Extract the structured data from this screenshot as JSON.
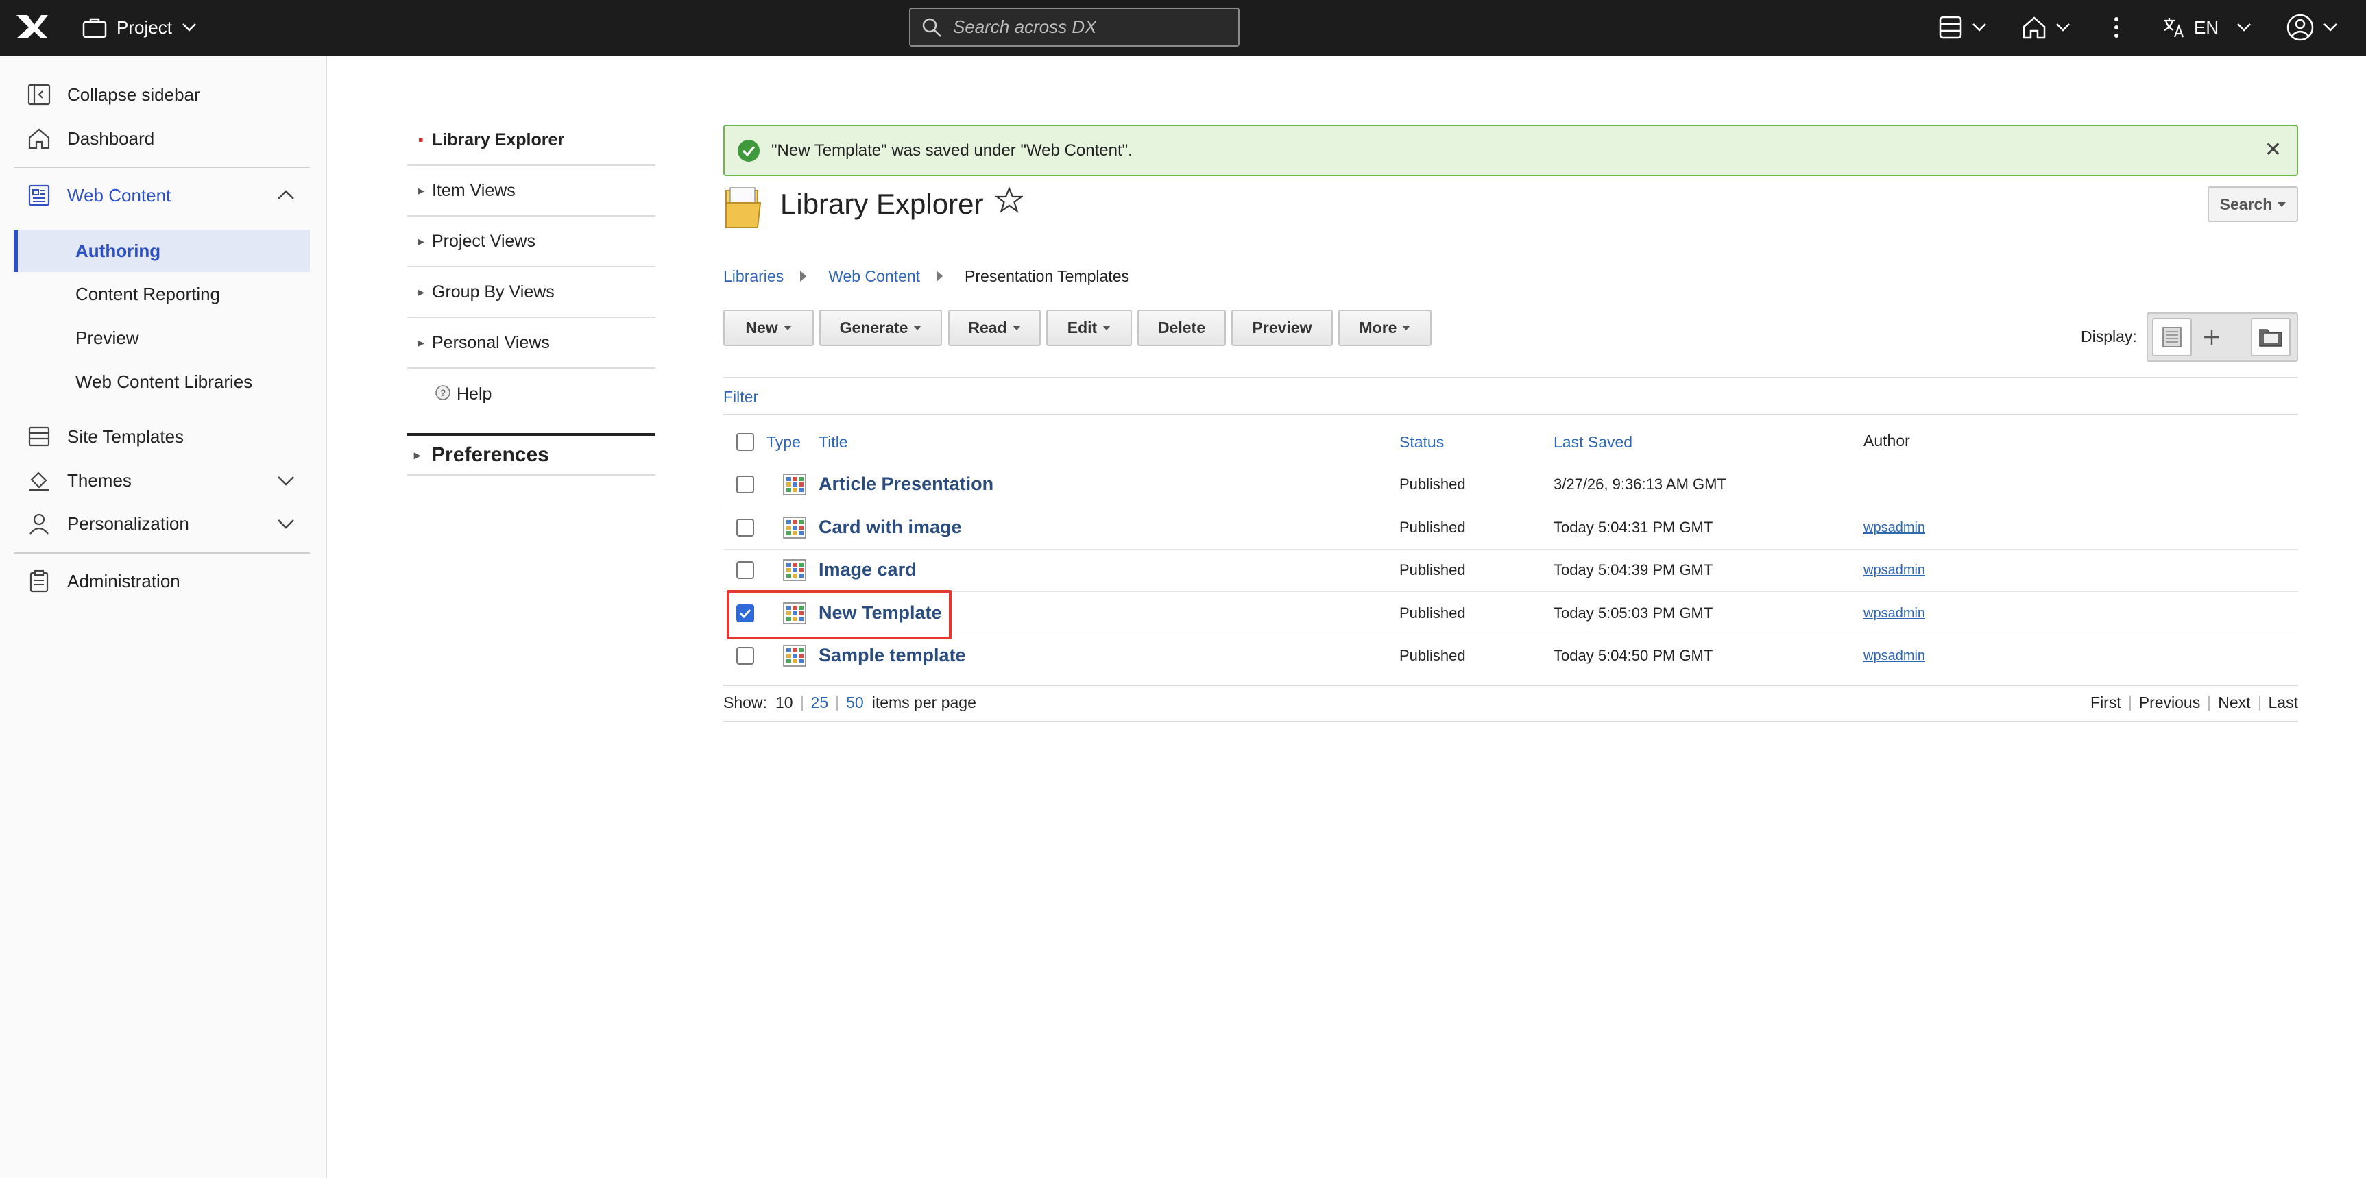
{
  "topbar": {
    "project_label": "Project",
    "search_placeholder": "Search across DX",
    "language": "EN"
  },
  "sidebar": {
    "collapse": "Collapse sidebar",
    "dashboard": "Dashboard",
    "web_content": "Web Content",
    "sub_items": [
      "Authoring",
      "Content Reporting",
      "Preview",
      "Web Content Libraries"
    ],
    "site_templates": "Site Templates",
    "themes": "Themes",
    "personalization": "Personalization",
    "administration": "Administration"
  },
  "nav": {
    "items": [
      "Library Explorer",
      "Item Views",
      "Project Views",
      "Group By Views",
      "Personal Views",
      "Help"
    ],
    "preferences": "Preferences"
  },
  "alert": {
    "message": "\"New Template\" was saved under \"Web Content\"."
  },
  "main": {
    "title": "Library Explorer",
    "search_button": "Search",
    "breadcrumb": [
      "Libraries",
      "Web Content",
      "Presentation Templates"
    ],
    "toolbar": {
      "new": "New",
      "generate": "Generate",
      "read": "Read",
      "edit": "Edit",
      "delete": "Delete",
      "preview": "Preview",
      "more": "More"
    },
    "display_label": "Display:",
    "filter": "Filter",
    "columns": {
      "type": "Type",
      "title": "Title",
      "status": "Status",
      "last_saved": "Last Saved",
      "author": "Author"
    },
    "rows": [
      {
        "title": "Article Presentation",
        "status": "Published",
        "last_saved": "3/27/26, 9:36:13 AM GMT",
        "author": "",
        "checked": false
      },
      {
        "title": "Card with image",
        "status": "Published",
        "last_saved": "Today 5:04:31 PM GMT",
        "author": "wpsadmin",
        "checked": false
      },
      {
        "title": "Image card",
        "status": "Published",
        "last_saved": "Today 5:04:39 PM GMT",
        "author": "wpsadmin",
        "checked": false
      },
      {
        "title": "New Template",
        "status": "Published",
        "last_saved": "Today 5:05:03 PM GMT",
        "author": "wpsadmin",
        "checked": true
      },
      {
        "title": "Sample template",
        "status": "Published",
        "last_saved": "Today 5:04:50 PM GMT",
        "author": "wpsadmin",
        "checked": false
      }
    ],
    "pagination": {
      "show_label": "Show:",
      "sizes": [
        "10",
        "25",
        "50"
      ],
      "suffix": "items per page",
      "first": "First",
      "previous": "Previous",
      "next": "Next",
      "last": "Last"
    }
  },
  "colors": {
    "accent": "#2f50c4",
    "link": "#2e66b6",
    "success_bg": "#e6f3dd",
    "highlight": "#e2382d"
  }
}
